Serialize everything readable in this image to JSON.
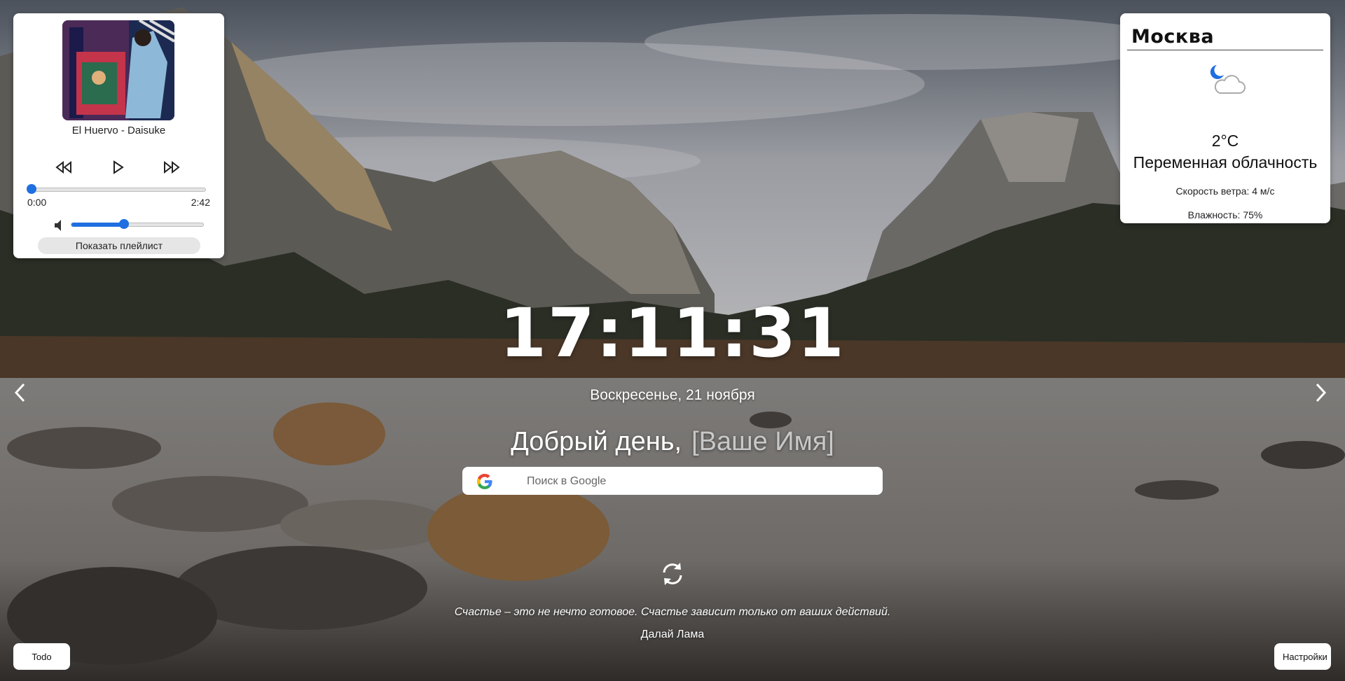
{
  "player": {
    "track_title": "El Huervo - Daisuke",
    "current_time": "0:00",
    "duration": "2:42",
    "progress_fraction": 0.0,
    "volume_fraction": 0.4,
    "playlist_button_label": "Показать плейлист",
    "icons": {
      "prev": "rewind-icon",
      "play": "play-icon",
      "next": "fast-forward-icon",
      "volume": "volume-icon"
    }
  },
  "weather": {
    "city": "Москва",
    "temperature": "2°C",
    "description": "Переменная облачность",
    "wind": "Скорость ветра: 4 м/с",
    "humidity": "Влажность: 75%",
    "icon": "night-partly-cloudy-icon"
  },
  "clock": {
    "time": "17:11:31",
    "date": "Воскресенье, 21 ноября"
  },
  "greeting": {
    "text": "Добрый день,",
    "name": "[Ваше Имя]"
  },
  "search": {
    "placeholder": "Поиск в Google",
    "engine_icon": "google-icon"
  },
  "quote": {
    "text": "Счастье – это не нечто готовое. Счастье зависит только от ваших действий.",
    "author": "Далай Лама"
  },
  "buttons": {
    "todo_label": "Todo",
    "settings_label": "Настройки"
  },
  "colors": {
    "accent": "#1e6fe0",
    "panel_bg": "#ffffff"
  }
}
